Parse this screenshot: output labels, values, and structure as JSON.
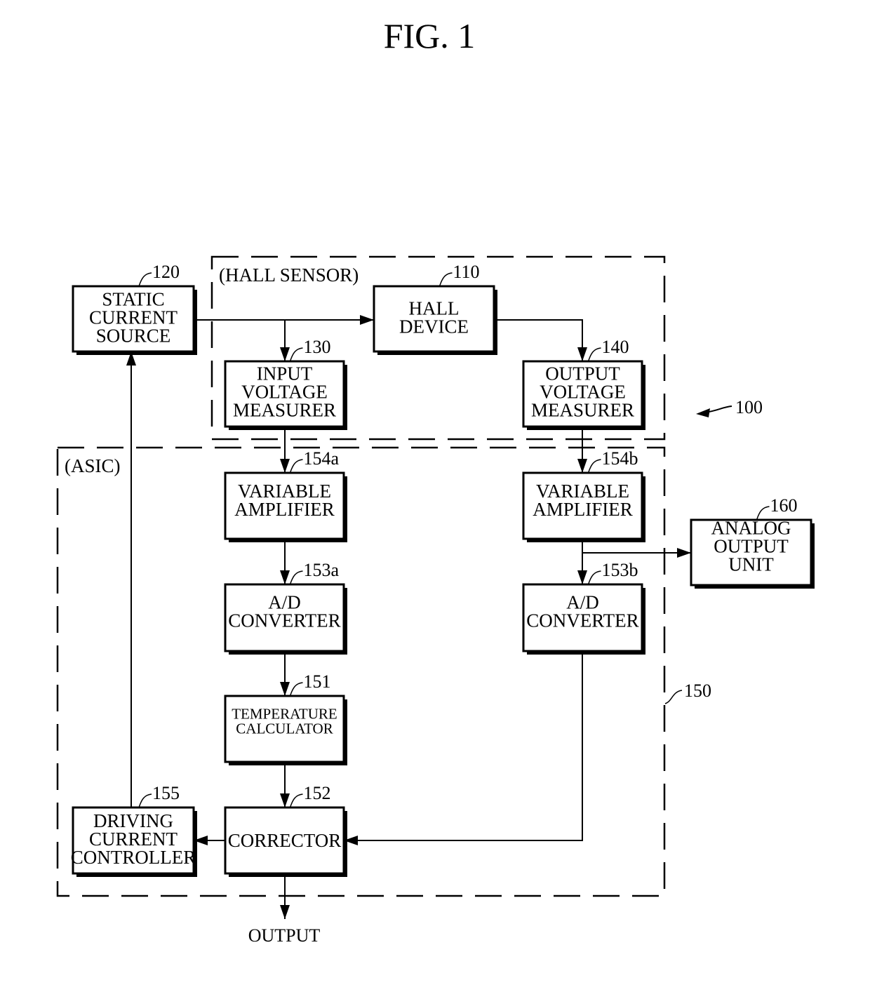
{
  "figure": {
    "title": "FIG. 1",
    "system_ref": "100",
    "output_label": "OUTPUT"
  },
  "groups": [
    {
      "id": "hall_sensor",
      "label": "(HALL SENSOR)",
      "ref": ""
    },
    {
      "id": "asic",
      "label": "(ASIC)",
      "ref": "150"
    }
  ],
  "blocks": [
    {
      "id": "static_current_source",
      "ref": "120",
      "lines": [
        "STATIC",
        "CURRENT",
        "SOURCE"
      ]
    },
    {
      "id": "hall_device",
      "ref": "110",
      "lines": [
        "HALL",
        "DEVICE"
      ]
    },
    {
      "id": "input_voltage_measurer",
      "ref": "130",
      "lines": [
        "INPUT",
        "VOLTAGE",
        "MEASURER"
      ]
    },
    {
      "id": "output_voltage_measurer",
      "ref": "140",
      "lines": [
        "OUTPUT",
        "VOLTAGE",
        "MEASURER"
      ]
    },
    {
      "id": "variable_amplifier_a",
      "ref": "154a",
      "lines": [
        "VARIABLE",
        "AMPLIFIER"
      ]
    },
    {
      "id": "variable_amplifier_b",
      "ref": "154b",
      "lines": [
        "VARIABLE",
        "AMPLIFIER"
      ]
    },
    {
      "id": "analog_output_unit",
      "ref": "160",
      "lines": [
        "ANALOG",
        "OUTPUT",
        "UNIT"
      ]
    },
    {
      "id": "ad_converter_a",
      "ref": "153a",
      "lines": [
        "A/D",
        "CONVERTER"
      ]
    },
    {
      "id": "ad_converter_b",
      "ref": "153b",
      "lines": [
        "A/D",
        "CONVERTER"
      ]
    },
    {
      "id": "temperature_calculator",
      "ref": "151",
      "lines": [
        "TEMPERATURE",
        "CALCULATOR"
      ]
    },
    {
      "id": "corrector",
      "ref": "152",
      "lines": [
        "CORRECTOR"
      ]
    },
    {
      "id": "driving_current_controller",
      "ref": "155",
      "lines": [
        "DRIVING",
        "CURRENT",
        "CONTROLLER"
      ]
    }
  ],
  "connections": [
    {
      "from": "static_current_source",
      "to": "hall_device"
    },
    {
      "from": "static_current_source",
      "to": "input_voltage_measurer"
    },
    {
      "from": "hall_device",
      "to": "output_voltage_measurer"
    },
    {
      "from": "input_voltage_measurer",
      "to": "variable_amplifier_a"
    },
    {
      "from": "output_voltage_measurer",
      "to": "variable_amplifier_b"
    },
    {
      "from": "variable_amplifier_a",
      "to": "ad_converter_a"
    },
    {
      "from": "variable_amplifier_b",
      "to": "ad_converter_b"
    },
    {
      "from": "variable_amplifier_b",
      "to": "analog_output_unit"
    },
    {
      "from": "ad_converter_a",
      "to": "temperature_calculator"
    },
    {
      "from": "temperature_calculator",
      "to": "corrector"
    },
    {
      "from": "ad_converter_b",
      "to": "corrector"
    },
    {
      "from": "corrector",
      "to": "driving_current_controller"
    },
    {
      "from": "driving_current_controller",
      "to": "static_current_source"
    },
    {
      "from": "corrector",
      "to": "output"
    }
  ]
}
